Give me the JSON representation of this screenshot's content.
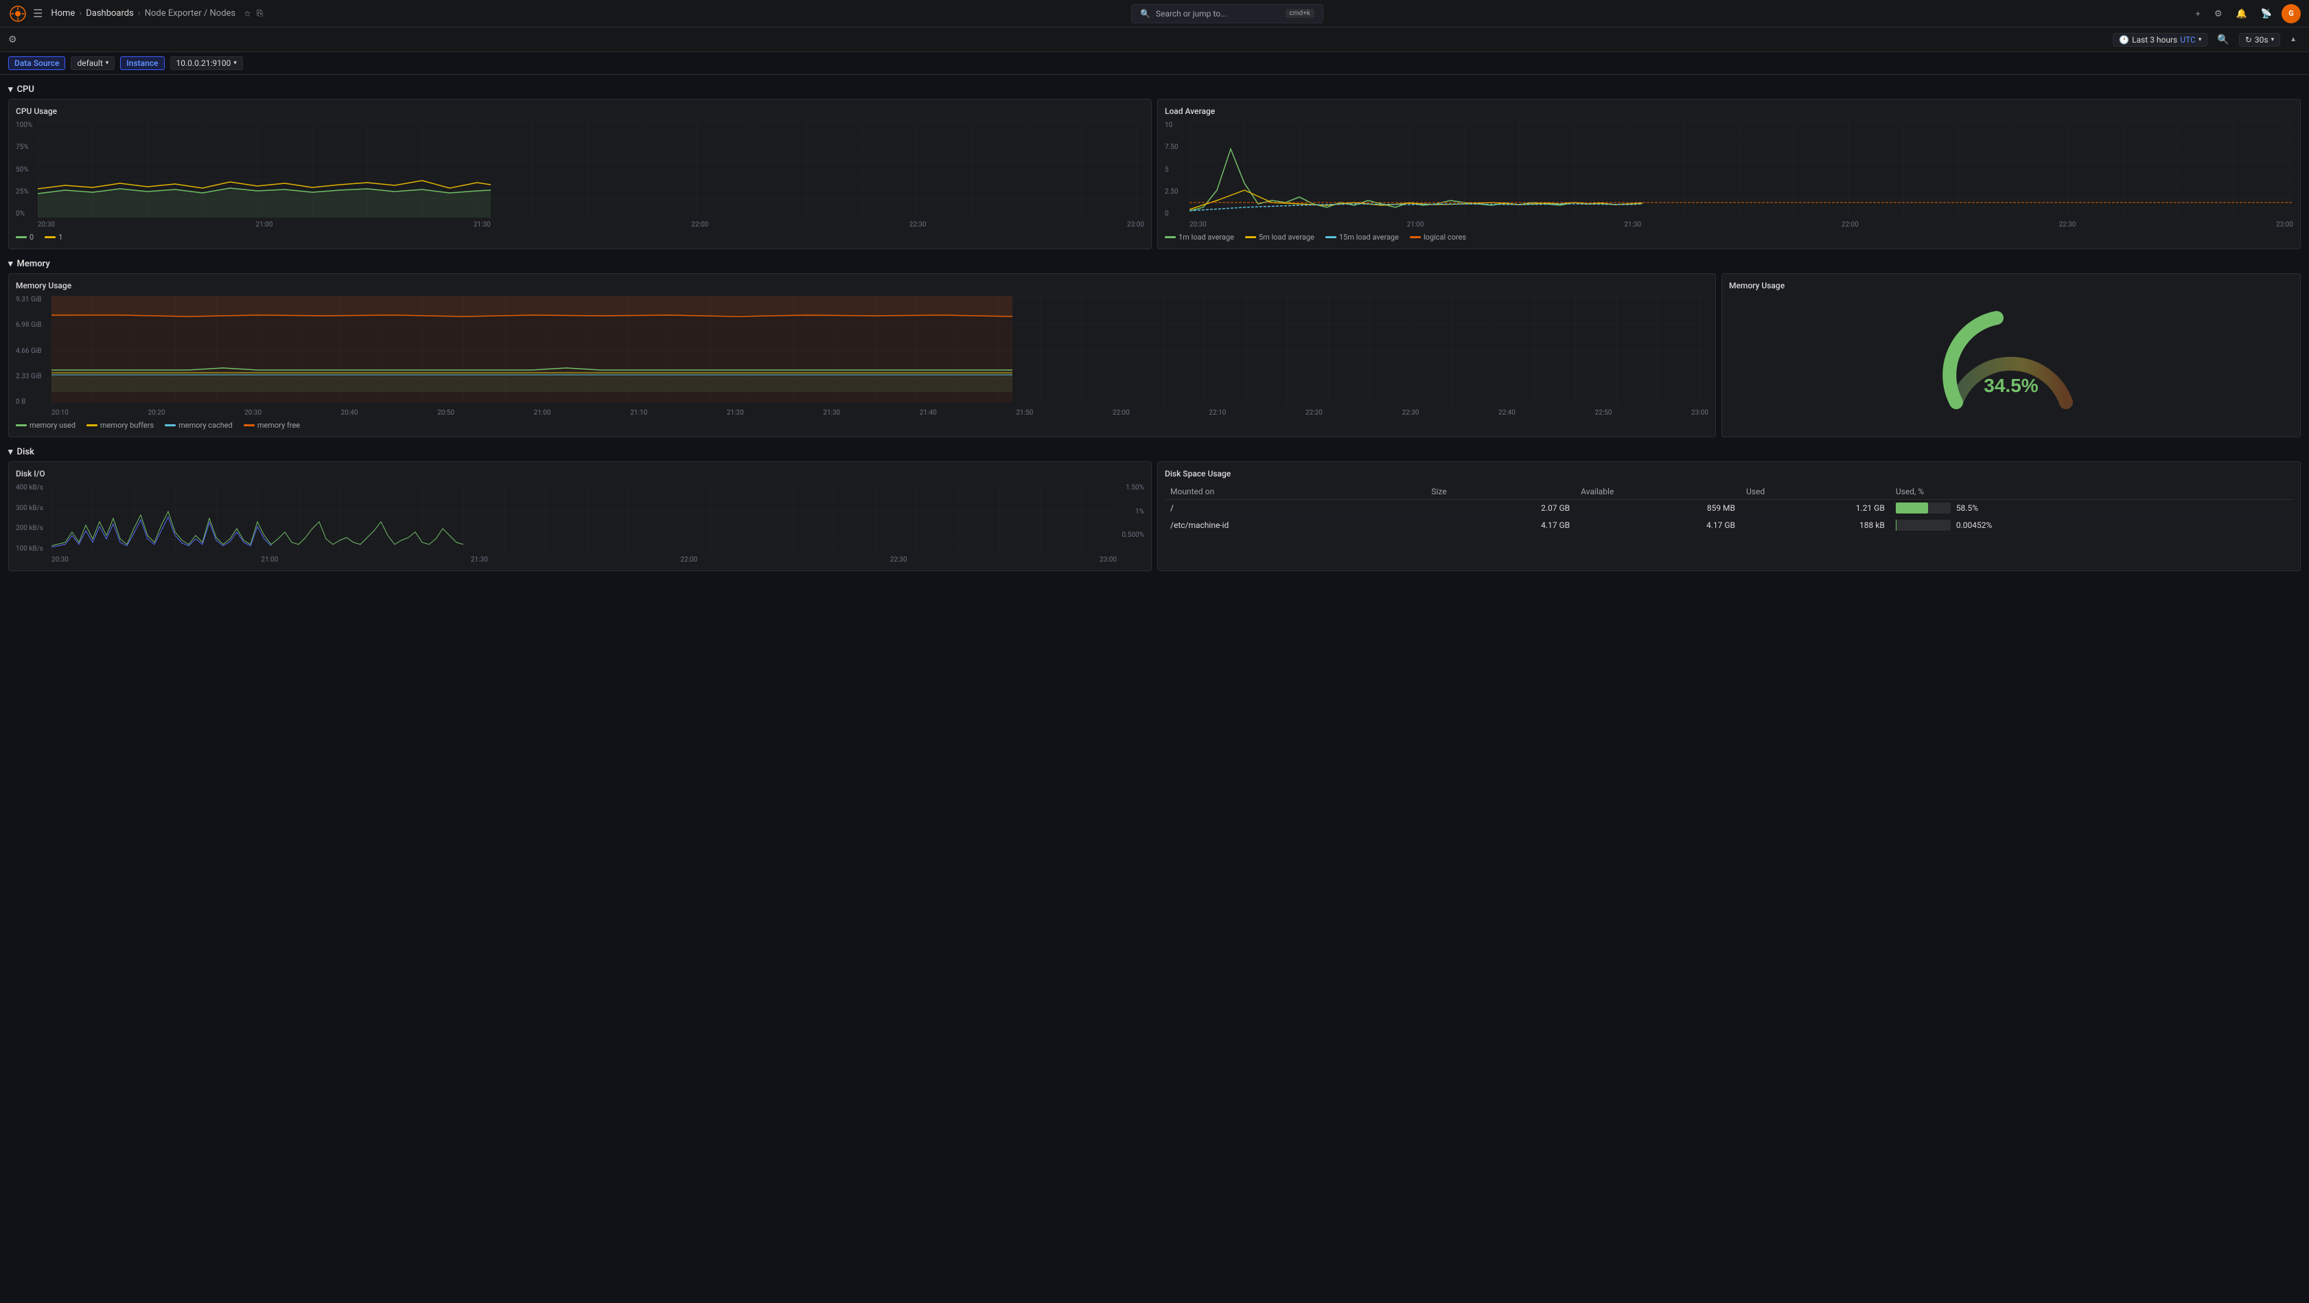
{
  "topbar": {
    "logo_alt": "Grafana",
    "search_placeholder": "Search or jump to...",
    "search_shortcut": "cmd+k",
    "actions": {
      "add_label": "+",
      "alerts_icon": "bell-icon",
      "settings_icon": "gear-icon",
      "user_initials": "G"
    }
  },
  "navbar": {
    "home": "Home",
    "dashboards": "Dashboards",
    "current": "Node Exporter / Nodes",
    "time_range": "Last 3 hours",
    "timezone": "UTC",
    "refresh": "30s",
    "settings_icon": "settings-icon",
    "zoom_out_icon": "zoom-out-icon",
    "refresh_icon": "refresh-icon",
    "collapse_icon": "chevron-up-icon"
  },
  "filterbar": {
    "datasource_label": "Data Source",
    "datasource_value": "default",
    "instance_label": "Instance",
    "instance_value": "10.0.0.21:9100"
  },
  "sections": {
    "cpu": {
      "label": "CPU",
      "collapsed": false,
      "cpu_usage": {
        "title": "CPU Usage",
        "y_labels": [
          "100%",
          "75%",
          "50%",
          "25%",
          "0%"
        ],
        "x_labels": [
          "20:30",
          "21:00",
          "21:30",
          "22:00",
          "22:30",
          "23:00"
        ],
        "legend": [
          {
            "label": "0",
            "color": "#73bf69"
          },
          {
            "label": "1",
            "color": "#e0b400"
          }
        ]
      },
      "load_average": {
        "title": "Load Average",
        "y_labels": [
          "10",
          "7.50",
          "5",
          "2.50",
          "0"
        ],
        "x_labels": [
          "20:30",
          "21:00",
          "21:30",
          "22:00",
          "22:30",
          "23:00"
        ],
        "legend": [
          {
            "label": "1m load average",
            "color": "#73bf69"
          },
          {
            "label": "5m load average",
            "color": "#e0b400"
          },
          {
            "label": "15m load average",
            "color": "#5bc0de"
          },
          {
            "label": "logical cores",
            "color": "#e05e00"
          }
        ]
      }
    },
    "memory": {
      "label": "Memory",
      "collapsed": false,
      "memory_usage_chart": {
        "title": "Memory Usage",
        "y_labels": [
          "9.31 GiB",
          "6.98 GiB",
          "4.66 GiB",
          "2.33 GiB",
          "0 B"
        ],
        "x_labels": [
          "20:10",
          "20:20",
          "20:30",
          "20:40",
          "20:50",
          "21:00",
          "21:10",
          "21:20",
          "21:30",
          "21:40",
          "21:50",
          "22:00",
          "22:10",
          "22:20",
          "22:30",
          "22:40",
          "22:50",
          "23:00"
        ],
        "legend": [
          {
            "label": "memory used",
            "color": "#73bf69"
          },
          {
            "label": "memory buffers",
            "color": "#e0b400"
          },
          {
            "label": "memory cached",
            "color": "#5bc0de"
          },
          {
            "label": "memory free",
            "color": "#e05e00"
          }
        ]
      },
      "memory_gauge": {
        "title": "Memory Usage",
        "value": "34.5%",
        "percentage": 34.5,
        "color": "#73bf69"
      }
    },
    "disk": {
      "label": "Disk",
      "collapsed": false,
      "disk_io": {
        "title": "Disk I/O",
        "y_labels_left": [
          "400 kB/s",
          "300 kB/s",
          "200 kB/s",
          "100 kB/s"
        ],
        "y_labels_right": [
          "1.50%",
          "1%",
          "0.500%"
        ],
        "x_labels": [
          "20:30",
          "21:00",
          "21:30",
          "22:00",
          "22:30",
          "23:00"
        ]
      },
      "disk_space": {
        "title": "Disk Space Usage",
        "columns": [
          "Mounted on",
          "Size",
          "Available",
          "Used",
          "Used, %"
        ],
        "rows": [
          {
            "mount": "/",
            "size": "2.07 GB",
            "available": "859 MB",
            "used": "1.21 GB",
            "used_pct": "58.5%",
            "bar_width": 58.5
          },
          {
            "mount": "/etc/machine-id",
            "size": "4.17 GB",
            "available": "4.17 GB",
            "used": "188 kB",
            "used_pct": "0.00452%",
            "bar_width": 0.1
          }
        ]
      }
    }
  }
}
